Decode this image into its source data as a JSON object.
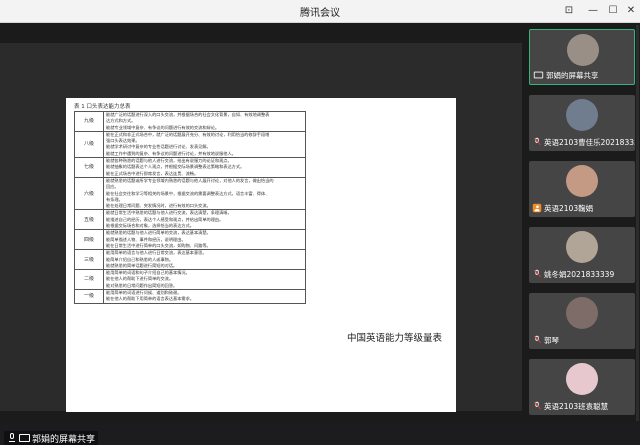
{
  "window": {
    "title": "腾讯会议"
  },
  "document": {
    "table_title": "表 1   口头表达能力总表",
    "rows": [
      {
        "level": "九级",
        "lines": [
          "能就广泛的话题进行深入的口头交流，并根据场合的社会文化背景，自如、有效地调整表",
          "达方式和方式。",
          "能就专业领域中复杂、有争议的问题进行有效的交流和辩论。"
        ]
      },
      {
        "level": "八级",
        "lines": [
          "能在正式和非正式场合中，就广泛的话题展开充分、有效的讨论，利用恰当的修辞手段增",
          "强口头表达效果。",
          "能就学术研讨中复杂的专业性话题进行讨论、发表见解。",
          "能就工作中遇到的复杂、有争议的问题进行讨论，并有效地说服他人。"
        ]
      },
      {
        "level": "七级",
        "lines": [
          "能就各种熟悉的话题与他人进行交流，给出有说服力的论证和观点。",
          "能就抽象的话题表达个人观点，并根据交际场景调整表达策略和表达方式。",
          "能在正式场合中进行即席发言，表达连贯、流畅。"
        ]
      },
      {
        "level": "六级",
        "lines": [
          "能就熟悉的话题或所学专业领域内熟悉的话题与他人展开讨论，对他人的发言，做出恰当的",
          "回应。",
          "能在社会交往和学习等相关的场景中，根据交流的需要调整表达方式，语言丰富、得体、",
          "有条理。",
          "能在处理日常问题、突发情况时，进行有效的口头交流。"
        ]
      },
      {
        "level": "五级",
        "lines": [
          "能就日常生活中熟悉的话题与他人进行交流，表达清楚，条理清晰。",
          "能描述自己的经历，表达个人感受和观点，并给出简单的理由。",
          "能根据交际场合和对象，选择恰当的表达方式。"
        ]
      },
      {
        "level": "四级",
        "lines": [
          "能就熟悉的话题与他人进行简单的交流，表达基本清楚。",
          "能简单描述人物、事件和经历，说明理由。",
          "能在日常生活中进行简单的口头交流，如购物、问路等。"
        ]
      },
      {
        "level": "三级",
        "lines": [
          "能用简单的语言与他人进行日常交流，表达基本意思。",
          "能简单介绍自己和熟悉的人或事物。",
          "能就熟悉的简单话题进行简短的对话。"
        ]
      },
      {
        "level": "二级",
        "lines": [
          "能用简单的词语和句子介绍自己的基本情况。",
          "能在他人的帮助下进行简单的交流。",
          "能对熟悉的日常问题作出简短的回答。"
        ]
      },
      {
        "level": "一级",
        "lines": [
          "能用简单的词语进行问候、道别和致谢。",
          "能在他人的帮助下用简单的语言表达基本需求。"
        ]
      }
    ],
    "caption": "中国英语能力等级量表"
  },
  "share_label": "郭娟的屏幕共享",
  "participants": [
    {
      "name": "郭娟的屏幕共享",
      "icon": "screen-share-icon",
      "active": true,
      "avatar_color": "#9a8f86"
    },
    {
      "name": "英语2103曹佳乐2021833...",
      "icon": "mic-off-icon",
      "active": false,
      "avatar_color": "#6f7d8e"
    },
    {
      "name": "英语2103鞠娟",
      "icon": "user-icon",
      "active": false,
      "avatar_color": "#c49a85"
    },
    {
      "name": "姚冬娟2021833339",
      "icon": "mic-off-icon",
      "active": false,
      "avatar_color": "#b0a597"
    },
    {
      "name": "郭琴",
      "icon": "mic-off-icon",
      "active": false,
      "avatar_color": "#7d6c67"
    },
    {
      "name": "英语2103班袁聪慧",
      "icon": "mic-off-icon",
      "active": false,
      "avatar_color": "#e7c8cf"
    }
  ]
}
